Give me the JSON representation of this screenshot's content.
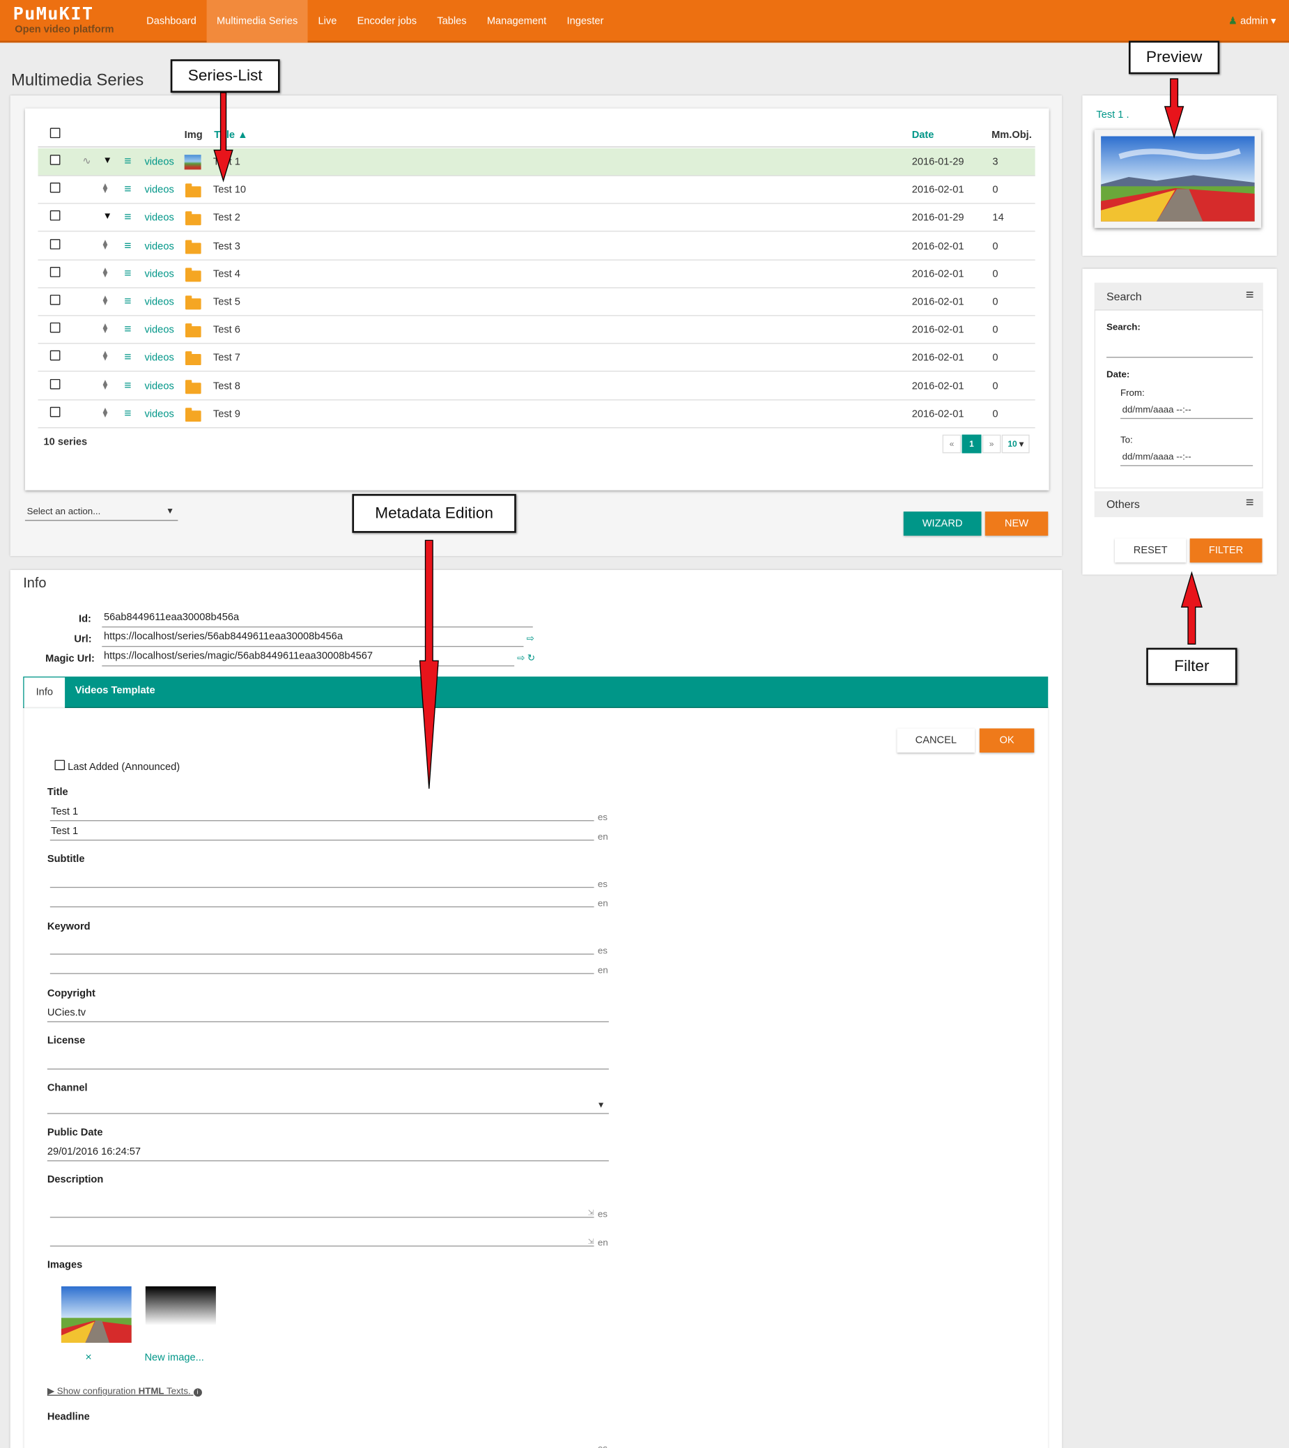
{
  "nav": {
    "logo": "PuMuKIT",
    "logo_sub": "Open video platform",
    "items": [
      "Dashboard",
      "Multimedia Series",
      "Live",
      "Encoder jobs",
      "Tables",
      "Management",
      "Ingester"
    ],
    "user": "admin"
  },
  "page_title": "Multimedia Series",
  "callouts": {
    "series_list": "Series-List",
    "preview": "Preview",
    "metadata": "Metadata Edition",
    "filter": "Filter"
  },
  "table": {
    "headers": {
      "img": "Img",
      "title": "Title",
      "date": "Date",
      "mmobj": "Mm.Obj."
    },
    "rows": [
      {
        "link": "videos",
        "title": "Test 1",
        "date": "2016-01-29",
        "count": "3",
        "selected": true
      },
      {
        "link": "videos",
        "title": "Test 10",
        "date": "2016-02-01",
        "count": "0"
      },
      {
        "link": "videos",
        "title": "Test 2",
        "date": "2016-01-29",
        "count": "14"
      },
      {
        "link": "videos",
        "title": "Test 3",
        "date": "2016-02-01",
        "count": "0"
      },
      {
        "link": "videos",
        "title": "Test 4",
        "date": "2016-02-01",
        "count": "0"
      },
      {
        "link": "videos",
        "title": "Test 5",
        "date": "2016-02-01",
        "count": "0"
      },
      {
        "link": "videos",
        "title": "Test 6",
        "date": "2016-02-01",
        "count": "0"
      },
      {
        "link": "videos",
        "title": "Test 7",
        "date": "2016-02-01",
        "count": "0"
      },
      {
        "link": "videos",
        "title": "Test 8",
        "date": "2016-02-01",
        "count": "0"
      },
      {
        "link": "videos",
        "title": "Test 9",
        "date": "2016-02-01",
        "count": "0"
      }
    ],
    "count_label": "10 series",
    "pager": {
      "prev": "«",
      "current": "1",
      "next": "»",
      "per_page": "10"
    }
  },
  "actions": {
    "select_placeholder": "Select an action...",
    "wizard": "WIZARD",
    "new": "NEW"
  },
  "preview": {
    "title": "Test 1 ."
  },
  "search": {
    "header": "Search",
    "search_label": "Search:",
    "date_label": "Date:",
    "from_label": "From:",
    "from_value": "dd/mm/aaaa --:--",
    "to_label": "To:",
    "to_value": "dd/mm/aaaa --:--",
    "others": "Others",
    "reset": "RESET",
    "filter": "FILTER"
  },
  "info": {
    "heading": "Info",
    "id_label": "Id:",
    "id_value": "56ab8449611eaa30008b456a",
    "url_label": "Url:",
    "url_value": "https://localhost/series/56ab8449611eaa30008b456a",
    "magic_label": "Magic Url:",
    "magic_value": "https://localhost/series/magic/56ab8449611eaa30008b4567",
    "tabs": [
      "Info",
      "Videos Template"
    ],
    "cancel": "CANCEL",
    "ok": "OK",
    "last_added": "Last Added (Announced)",
    "title_label": "Title",
    "title_es": "Test 1",
    "title_en": "Test 1",
    "subtitle_label": "Subtitle",
    "keyword_label": "Keyword",
    "copyright_label": "Copyright",
    "copyright_value": "UCies.tv",
    "license_label": "License",
    "channel_label": "Channel",
    "public_date_label": "Public Date",
    "public_date_value": "29/01/2016 16:24:57",
    "description_label": "Description",
    "images_label": "Images",
    "remove_image": "×",
    "new_image": "New image...",
    "show_config_pre": "▶ Show configuration ",
    "show_config_html": "HTML",
    "show_config_post": " Texts.",
    "headline_label": "Headline",
    "lang_es": "es",
    "lang_en": "en"
  },
  "colors": {
    "brand": "#ed7011",
    "accent": "#009688",
    "selected_row": "#dff0d8"
  }
}
